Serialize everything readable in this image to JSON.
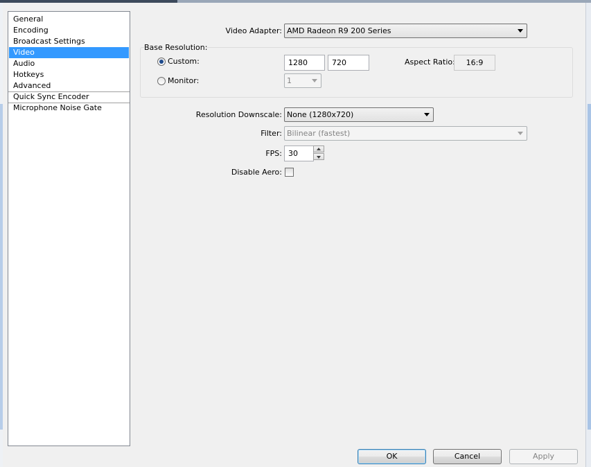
{
  "sidebar": {
    "items": [
      {
        "label": "General"
      },
      {
        "label": "Encoding"
      },
      {
        "label": "Broadcast Settings"
      },
      {
        "label": "Video"
      },
      {
        "label": "Audio"
      },
      {
        "label": "Hotkeys"
      },
      {
        "label": "Advanced"
      },
      {
        "label": "Quick Sync Encoder"
      },
      {
        "label": "Microphone Noise Gate"
      }
    ],
    "selected": "Video"
  },
  "video": {
    "adapter_label": "Video Adapter:",
    "adapter_value": "AMD Radeon R9 200 Series",
    "base_resolution_title": "Base Resolution:",
    "custom_label": "Custom:",
    "custom_selected": true,
    "width": "1280",
    "height": "720",
    "aspect_label": "Aspect Ratio:",
    "aspect_value": "16:9",
    "monitor_label": "Monitor:",
    "monitor_value": "1",
    "downscale_label": "Resolution Downscale:",
    "downscale_value": "None  (1280x720)",
    "filter_label": "Filter:",
    "filter_value": "Bilinear (fastest)",
    "fps_label": "FPS:",
    "fps_value": "30",
    "disable_aero_label": "Disable Aero:",
    "disable_aero_checked": false
  },
  "buttons": {
    "ok": "OK",
    "cancel": "Cancel",
    "apply": "Apply"
  },
  "icons": [
    "radio-selected-icon",
    "radio-icon",
    "dropdown-arrow-icon",
    "spin-up-icon",
    "spin-down-icon",
    "checkbox-icon"
  ]
}
